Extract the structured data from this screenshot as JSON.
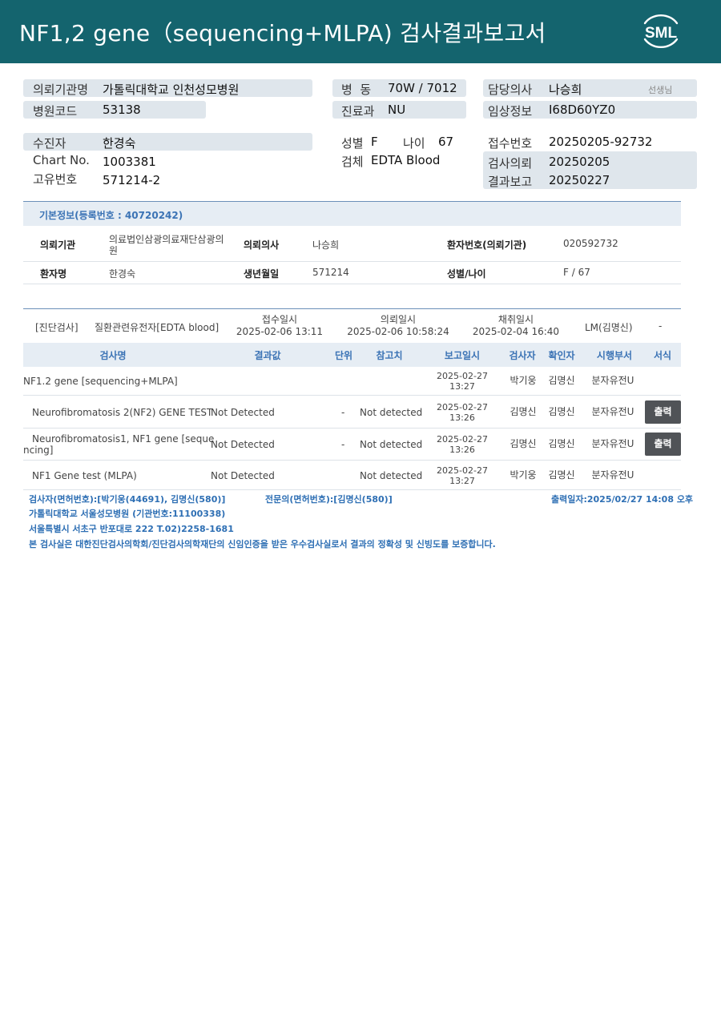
{
  "header": {
    "title": "NF1,2  gene（sequencing+MLPA) 검사결과보고서",
    "logo_text": "SML",
    "color": "#14646e"
  },
  "info": {
    "institution_label": "의뢰기관명",
    "institution": "가톨릭대학교 인천성모병원",
    "hospital_code_label": "병원코드",
    "hospital_code": "53138",
    "ward_label": "병  동",
    "ward": "70W / 7012",
    "dept_label": "진료과",
    "dept": "NU",
    "doctor_label": "담당의사",
    "doctor": "나승희",
    "doctor_suffix": "선생님",
    "clinical_label": "임상정보",
    "clinical": "I68D60YZ0",
    "patient_label": "수진자",
    "patient": "한경숙",
    "chart_label": "Chart No.",
    "chart": "1003381",
    "uid_label": "고유번호",
    "uid": "571214-2",
    "sex_label": "성별",
    "sex": "F",
    "age_label": "나이",
    "age": "67",
    "specimen_label": "검체",
    "specimen": "EDTA Blood",
    "receipt_label": "접수번호",
    "receipt": "20250205-92732",
    "request_label": "검사의뢰",
    "request": "20250205",
    "report_label": "결과보고",
    "report": "20250227"
  },
  "basic": {
    "heading": "기본정보(등록번호 : 40720242)",
    "inst_key": "의뢰기관",
    "inst_val_line1": "의료법인삼광의료재단삼광의",
    "inst_val_line2": "원",
    "doc_key": "의뢰의사",
    "doc_val": "나승희",
    "pno_key": "환자번호(의뢰기관)",
    "pno_val": "020592732",
    "name_key": "환자명",
    "name_val": "한경숙",
    "dob_key": "생년월일",
    "dob_val": "571214",
    "sexage_key": "성별/나이",
    "sexage_val": "F / 67"
  },
  "diag": {
    "type": "[진단검사]",
    "name": "질환관련유전자[EDTA blood]",
    "received_label": "접수일시",
    "received": "2025-02-06 13:11",
    "requested_label": "의뢰일시",
    "requested": "2025-02-06 10:58:24",
    "collected_label": "채취일시",
    "collected": "2025-02-04 16:40",
    "lab": "LM(김명신)",
    "dash": "-"
  },
  "table": {
    "headers": [
      "검사명",
      "결과값",
      "단위",
      "참고치",
      "보고일시",
      "검사자",
      "확인자",
      "시행부서",
      "서식"
    ],
    "rows": [
      {
        "name_line1": "NF1.2 gene [sequencing+MLPA]",
        "name_line2": "",
        "result": "",
        "unit": "",
        "ref": "",
        "date": "2025-02-27",
        "time": "13:27",
        "tester": "박기웅",
        "confirmer": "김명신",
        "dept": "분자유전U",
        "action": ""
      },
      {
        "name_line1": "Neurofibromatosis 2(NF2) GENE TEST",
        "name_line2": "",
        "result": "Not Detected",
        "unit": "-",
        "ref": "Not detected",
        "date": "2025-02-27",
        "time": "13:26",
        "tester": "김명신",
        "confirmer": "김명신",
        "dept": "분자유전U",
        "action": "출력"
      },
      {
        "name_line1": "Neurofibromatosis1, NF1 gene [seque",
        "name_line2": "ncing]",
        "result": "Not Detected",
        "unit": "-",
        "ref": "Not detected",
        "date": "2025-02-27",
        "time": "13:26",
        "tester": "김명신",
        "confirmer": "김명신",
        "dept": "분자유전U",
        "action": "출력"
      },
      {
        "name_line1": "NF1 Gene test (MLPA)",
        "name_line2": "",
        "result": "Not Detected",
        "unit": "",
        "ref": "Not detected",
        "date": "2025-02-27",
        "time": "13:27",
        "tester": "박기웅",
        "confirmer": "김명신",
        "dept": "분자유전U",
        "action": ""
      }
    ]
  },
  "footer": {
    "testers": "검사자(면허번호):[박기웅(44691), 김명신(580)]",
    "specialist": "전문의(면허번호):[김명신(580)]",
    "printed": "출력일자:2025/02/27 14:08 오후",
    "hospital": "가톨릭대학교 서울성모병원 (기관번호:11100338)",
    "address": "서울특별시 서초구 반포대로 222 T.02)2258-1681",
    "cert": "본 검사실은 대한진단검사의학회/진단검사의학재단의 신임인증을 받은 우수검사실로서 결과의 정확성 및 신빙도를 보증합니다."
  }
}
